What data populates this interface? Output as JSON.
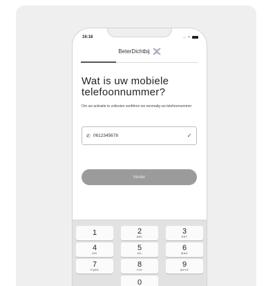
{
  "status_bar": {
    "time": "16:18",
    "signal": "...",
    "wifi": "≈"
  },
  "brand": {
    "name": "BeterDichtbij"
  },
  "progress": 0.3,
  "screen": {
    "title": "Wat is uw mobiele telefoonnummer?",
    "subtitle": "Om uw activatie te voltooien verifiëren we eenmalig uw telefoonnummer"
  },
  "phone_field": {
    "value": "0612345678"
  },
  "submit": {
    "label": "Verder"
  },
  "keypad": {
    "keys": [
      {
        "digit": "1",
        "letters": ""
      },
      {
        "digit": "2",
        "letters": "ABC"
      },
      {
        "digit": "3",
        "letters": "DEF"
      },
      {
        "digit": "4",
        "letters": "GHI"
      },
      {
        "digit": "5",
        "letters": "JKL"
      },
      {
        "digit": "6",
        "letters": "MNO"
      },
      {
        "digit": "7",
        "letters": "PQRS"
      },
      {
        "digit": "8",
        "letters": "TUV"
      },
      {
        "digit": "9",
        "letters": "WXYZ"
      },
      {
        "digit": "",
        "letters": ""
      },
      {
        "digit": "0",
        "letters": ""
      },
      {
        "digit": "",
        "letters": ""
      }
    ]
  },
  "colors": {
    "button_disabled": "#9b9b9b",
    "panel_bg": "#efeff0",
    "keypad_bg": "#e2e2e2"
  }
}
